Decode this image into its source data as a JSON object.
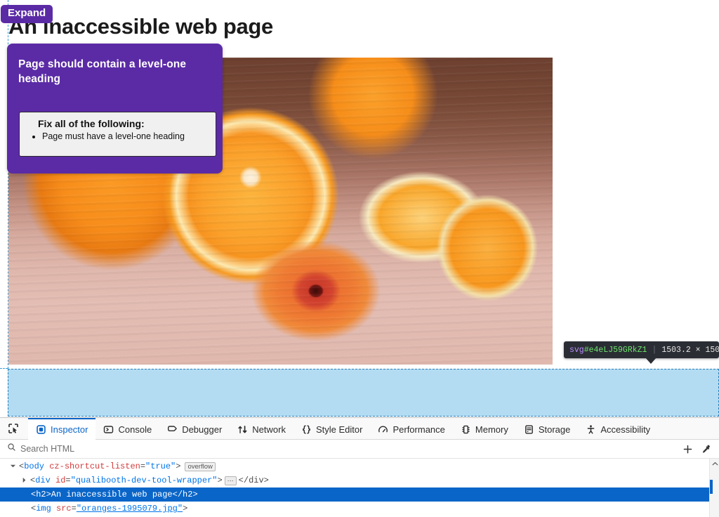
{
  "page": {
    "heading": "An inaccessible web page",
    "image_alt_missing": true
  },
  "a11y_overlay": {
    "expand_label": "Expand",
    "message": "Page should contain a level-one heading",
    "fix_title": "Fix all of the following:",
    "fix_items": [
      "Page must have a level-one heading"
    ],
    "panel_color": "#5b2ba6",
    "fixbox_bg": "#f0f0f0"
  },
  "element_tooltip": {
    "tag": "svg",
    "id": "#e4eLJ59GRkZ1",
    "separator": "|",
    "dimensions": "1503.2 × 150"
  },
  "devtools": {
    "picker_icon": "element-picker-icon",
    "tabs": [
      {
        "label": "Inspector",
        "icon": "inspector-icon",
        "active": true
      },
      {
        "label": "Console",
        "icon": "console-icon",
        "active": false
      },
      {
        "label": "Debugger",
        "icon": "debugger-icon",
        "active": false
      },
      {
        "label": "Network",
        "icon": "network-icon",
        "active": false
      },
      {
        "label": "Style Editor",
        "icon": "style-editor-icon",
        "active": false
      },
      {
        "label": "Performance",
        "icon": "performance-icon",
        "active": false
      },
      {
        "label": "Memory",
        "icon": "memory-icon",
        "active": false
      },
      {
        "label": "Storage",
        "icon": "storage-icon",
        "active": false
      },
      {
        "label": "Accessibility",
        "icon": "accessibility-icon",
        "active": false
      }
    ],
    "search": {
      "placeholder": "Search HTML",
      "value": "",
      "icon": "search-icon"
    },
    "actions": [
      {
        "name": "add-node-button",
        "icon": "plus-icon"
      },
      {
        "name": "eyedropper-button",
        "icon": "eyedropper-icon"
      }
    ],
    "markup": {
      "accent_color": "#0a65c8",
      "rows": [
        {
          "indent": 1,
          "twisty": "expanded",
          "tag": "body",
          "attr_name": "cz-shortcut-listen",
          "attr_value": "\"true\"",
          "badge": "overflow",
          "selected": false
        },
        {
          "indent": 2,
          "twisty": "collapsed",
          "tag": "div",
          "attr_name": "id",
          "attr_value": "\"qualibooth-dev-tool-wrapper\"",
          "closing": "</div>",
          "selected": false
        },
        {
          "indent": 3,
          "twisty": "none",
          "text": "<h2>An inaccessible web page</h2>",
          "selected": true
        },
        {
          "indent": 3,
          "twisty": "none",
          "tag": "img",
          "attr_name": "src",
          "attr_value": "\"oranges-1995079.jpg\"",
          "selected": false
        }
      ]
    }
  }
}
